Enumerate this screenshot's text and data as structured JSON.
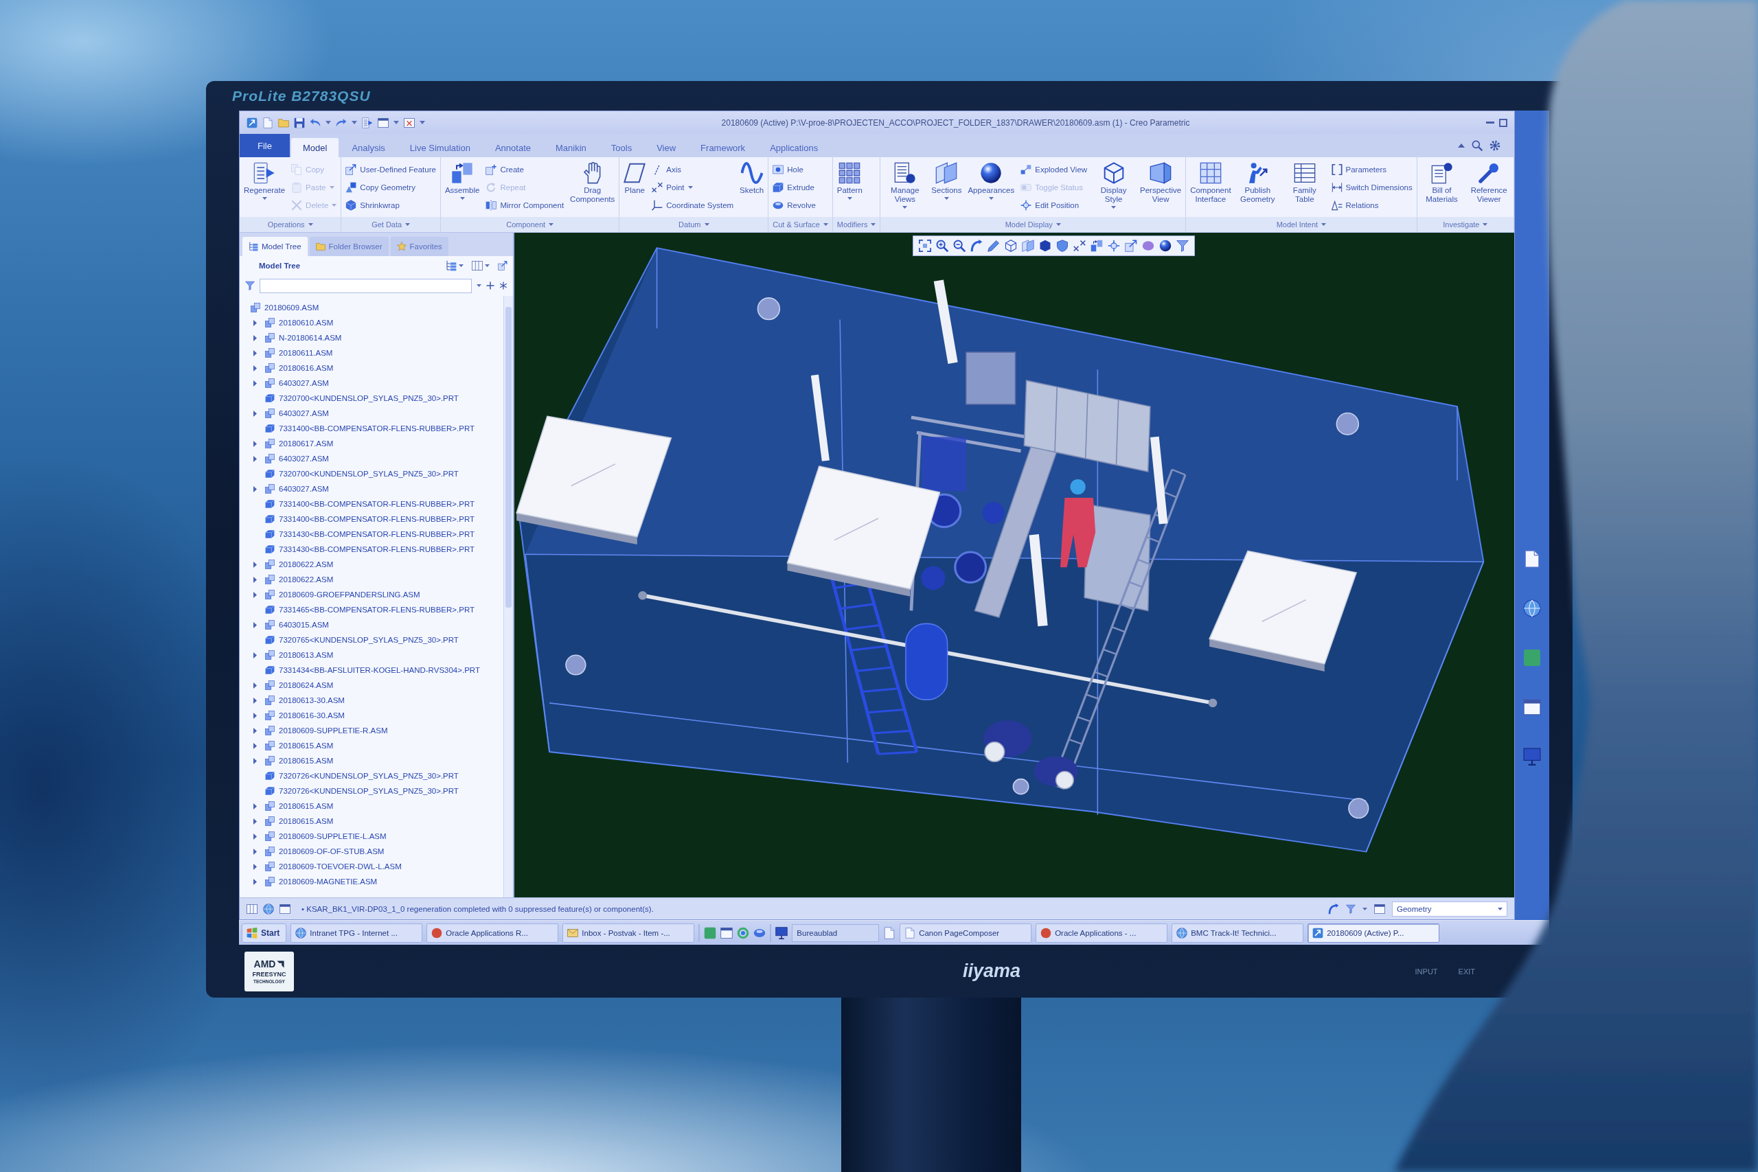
{
  "monitor": {
    "model": "ProLite B2783QSU",
    "logo": "iiyama",
    "sticker": {
      "brand": "AMD",
      "lines": [
        "FREESYNC",
        "TECHNOLOGY"
      ]
    },
    "buttons": [
      "INPUT",
      "EXIT"
    ]
  },
  "window": {
    "title": "20180609 (Active) P:\\V-proe-8\\PROJECTEN_ACCO\\PROJECT_FOLDER_1837\\DRAWER\\20180609.asm (1) - Creo Parametric"
  },
  "ribbon": {
    "tabs": [
      {
        "label": "File",
        "kind": "menu",
        "selected": false
      },
      {
        "label": "Model",
        "kind": "tab",
        "selected": true
      },
      {
        "label": "Analysis",
        "kind": "tab",
        "selected": false
      },
      {
        "label": "Live Simulation",
        "kind": "tab",
        "selected": false
      },
      {
        "label": "Annotate",
        "kind": "tab",
        "selected": false
      },
      {
        "label": "Manikin",
        "kind": "tab",
        "selected": false
      },
      {
        "label": "Tools",
        "kind": "tab",
        "selected": false
      },
      {
        "label": "View",
        "kind": "tab",
        "selected": false
      },
      {
        "label": "Framework",
        "kind": "tab",
        "selected": false
      },
      {
        "label": "Applications",
        "kind": "tab",
        "selected": false
      }
    ],
    "groups": [
      {
        "label": "Operations",
        "items": [
          {
            "label": "Regenerate",
            "kind": "large",
            "disabled": false,
            "dropdown": true
          },
          {
            "label": "Copy",
            "kind": "small",
            "disabled": true,
            "dropdown": false
          },
          {
            "label": "Paste",
            "kind": "small",
            "disabled": true,
            "dropdown": true
          },
          {
            "label": "Delete",
            "kind": "small",
            "disabled": true,
            "dropdown": true
          }
        ]
      },
      {
        "label": "Get Data",
        "items": [
          {
            "label": "User-Defined Feature",
            "kind": "small",
            "disabled": false,
            "dropdown": false
          },
          {
            "label": "Copy Geometry",
            "kind": "small",
            "disabled": false,
            "dropdown": false
          },
          {
            "label": "Shrinkwrap",
            "kind": "small",
            "disabled": false,
            "dropdown": false
          }
        ]
      },
      {
        "label": "Component",
        "items": [
          {
            "label": "Assemble",
            "kind": "large",
            "disabled": false,
            "dropdown": true
          },
          {
            "label": "Create",
            "kind": "small",
            "disabled": false,
            "dropdown": false
          },
          {
            "label": "Repeat",
            "kind": "small",
            "disabled": true,
            "dropdown": false
          },
          {
            "label": "Mirror Component",
            "kind": "small",
            "disabled": false,
            "dropdown": false
          },
          {
            "label": "Drag Components",
            "kind": "large",
            "disabled": false,
            "dropdown": false
          }
        ]
      },
      {
        "label": "Datum",
        "items": [
          {
            "label": "Plane",
            "kind": "large",
            "disabled": false,
            "dropdown": false
          },
          {
            "label": "Axis",
            "kind": "small",
            "disabled": false,
            "dropdown": false
          },
          {
            "label": "Point",
            "kind": "small",
            "disabled": false,
            "dropdown": true
          },
          {
            "label": "Coordinate System",
            "kind": "small",
            "disabled": false,
            "dropdown": false
          },
          {
            "label": "Sketch",
            "kind": "large",
            "disabled": false,
            "dropdown": false
          }
        ]
      },
      {
        "label": "Cut & Surface",
        "items": [
          {
            "label": "Hole",
            "kind": "small",
            "disabled": false,
            "dropdown": false
          },
          {
            "label": "Extrude",
            "kind": "small",
            "disabled": false,
            "dropdown": false
          },
          {
            "label": "Revolve",
            "kind": "small",
            "disabled": false,
            "dropdown": false
          }
        ]
      },
      {
        "label": "Modifiers",
        "items": [
          {
            "label": "Pattern",
            "kind": "large",
            "disabled": false,
            "dropdown": true
          }
        ]
      },
      {
        "label": "Model Display",
        "items": [
          {
            "label": "Manage Views",
            "kind": "large",
            "disabled": false,
            "dropdown": true
          },
          {
            "label": "Sections",
            "kind": "large",
            "disabled": false,
            "dropdown": true
          },
          {
            "label": "Appearances",
            "kind": "large",
            "disabled": false,
            "dropdown": true
          },
          {
            "label": "Exploded View",
            "kind": "small",
            "disabled": false,
            "dropdown": false
          },
          {
            "label": "Toggle Status",
            "kind": "small",
            "disabled": true,
            "dropdown": false
          },
          {
            "label": "Edit Position",
            "kind": "small",
            "disabled": false,
            "dropdown": false
          },
          {
            "label": "Display Style",
            "kind": "large",
            "disabled": false,
            "dropdown": true
          },
          {
            "label": "Perspective View",
            "kind": "large",
            "disabled": false,
            "dropdown": false
          }
        ]
      },
      {
        "label": "Model Intent",
        "items": [
          {
            "label": "Component Interface",
            "kind": "large",
            "disabled": false,
            "dropdown": false
          },
          {
            "label": "Publish Geometry",
            "kind": "large",
            "disabled": false,
            "dropdown": false
          },
          {
            "label": "Family Table",
            "kind": "large",
            "disabled": false,
            "dropdown": false
          },
          {
            "label": "Parameters",
            "kind": "small",
            "disabled": false,
            "dropdown": false
          },
          {
            "label": "Switch Dimensions",
            "kind": "small",
            "disabled": false,
            "dropdown": false
          },
          {
            "label": "Relations",
            "kind": "small",
            "disabled": false,
            "dropdown": false
          }
        ]
      },
      {
        "label": "Investigate",
        "items": [
          {
            "label": "Bill of Materials",
            "kind": "large",
            "disabled": false,
            "dropdown": false
          },
          {
            "label": "Reference Viewer",
            "kind": "large",
            "disabled": false,
            "dropdown": false
          }
        ]
      }
    ]
  },
  "model_tree": {
    "tabs": [
      {
        "label": "Model Tree",
        "selected": true
      },
      {
        "label": "Folder Browser",
        "selected": false
      },
      {
        "label": "Favorites",
        "selected": false
      }
    ],
    "heading": "Model Tree",
    "root": {
      "label": "20180609.ASM",
      "children": [
        {
          "label": "20180610.ASM",
          "kind": "assembly",
          "expanded": false
        },
        {
          "label": "N-20180614.ASM",
          "kind": "assembly",
          "expanded": false
        },
        {
          "label": "20180611.ASM",
          "kind": "assembly",
          "expanded": false
        },
        {
          "label": "20180616.ASM",
          "kind": "assembly",
          "expanded": false
        },
        {
          "label": "6403027.ASM",
          "kind": "assembly",
          "expanded": false
        },
        {
          "label": "7320700<KUNDENSLOP_SYLAS_PNZ5_30>.PRT",
          "kind": "part"
        },
        {
          "label": "6403027.ASM",
          "kind": "assembly",
          "expanded": false
        },
        {
          "label": "7331400<BB-COMPENSATOR-FLENS-RUBBER>.PRT",
          "kind": "part"
        },
        {
          "label": "20180617.ASM",
          "kind": "assembly",
          "expanded": false
        },
        {
          "label": "6403027.ASM",
          "kind": "assembly",
          "expanded": false
        },
        {
          "label": "7320700<KUNDENSLOP_SYLAS_PNZ5_30>.PRT",
          "kind": "part"
        },
        {
          "label": "6403027.ASM",
          "kind": "assembly",
          "expanded": false
        },
        {
          "label": "7331400<BB-COMPENSATOR-FLENS-RUBBER>.PRT",
          "kind": "part"
        },
        {
          "label": "7331400<BB-COMPENSATOR-FLENS-RUBBER>.PRT",
          "kind": "part"
        },
        {
          "label": "7331430<BB-COMPENSATOR-FLENS-RUBBER>.PRT",
          "kind": "part"
        },
        {
          "label": "7331430<BB-COMPENSATOR-FLENS-RUBBER>.PRT",
          "kind": "part"
        },
        {
          "label": "20180622.ASM",
          "kind": "assembly",
          "expanded": false
        },
        {
          "label": "20180622.ASM",
          "kind": "assembly",
          "expanded": false
        },
        {
          "label": "20180609-GROEFPANDERSLING.ASM",
          "kind": "assembly",
          "expanded": false
        },
        {
          "label": "7331465<BB-COMPENSATOR-FLENS-RUBBER>.PRT",
          "kind": "part"
        },
        {
          "label": "6403015.ASM",
          "kind": "assembly",
          "expanded": false
        },
        {
          "label": "7320765<KUNDENSLOP_SYLAS_PNZ5_30>.PRT",
          "kind": "part"
        },
        {
          "label": "20180613.ASM",
          "kind": "assembly",
          "expanded": false
        },
        {
          "label": "7331434<BB-AFSLUITER-KOGEL-HAND-RVS304>.PRT",
          "kind": "part"
        },
        {
          "label": "20180624.ASM",
          "kind": "assembly",
          "expanded": false
        },
        {
          "label": "20180613-30.ASM",
          "kind": "assembly",
          "expanded": false
        },
        {
          "label": "20180616-30.ASM",
          "kind": "assembly",
          "expanded": false
        },
        {
          "label": "20180609-SUPPLETIE-R.ASM",
          "kind": "assembly",
          "expanded": false
        },
        {
          "label": "20180615.ASM",
          "kind": "assembly",
          "expanded": false
        },
        {
          "label": "20180615.ASM",
          "kind": "assembly",
          "expanded": false
        },
        {
          "label": "7320726<KUNDENSLOP_SYLAS_PNZ5_30>.PRT",
          "kind": "part"
        },
        {
          "label": "7320726<KUNDENSLOP_SYLAS_PNZ5_30>.PRT",
          "kind": "part"
        },
        {
          "label": "20180615.ASM",
          "kind": "assembly",
          "expanded": false
        },
        {
          "label": "20180615.ASM",
          "kind": "assembly",
          "expanded": false
        },
        {
          "label": "20180609-SUPPLETIE-L.ASM",
          "kind": "assembly",
          "expanded": false
        },
        {
          "label": "20180609-OF-OF-STUB.ASM",
          "kind": "assembly",
          "expanded": false
        },
        {
          "label": "20180609-TOEVOER-DWL-L.ASM",
          "kind": "assembly",
          "expanded": false
        },
        {
          "label": "20180609-MAGNETIE.ASM",
          "kind": "assembly",
          "expanded": false
        }
      ]
    }
  },
  "status_bar": {
    "message": "• KSAR_BK1_VIR-DP03_1_0 regeneration completed with 0 suppressed feature(s) or component(s).",
    "filter": "Geometry"
  },
  "taskbar": {
    "start": "Start",
    "buttons_left": [
      {
        "label": "Intranet TPG - Internet ...",
        "selected": false
      },
      {
        "label": "Oracle Applications R...",
        "selected": false
      },
      {
        "label": "Inbox - Postvak - Item -...",
        "selected": false
      }
    ],
    "desktop_toolbar": "Bureaublad",
    "buttons_right": [
      {
        "label": "Canon PageComposer",
        "selected": false
      },
      {
        "label": "Oracle Applications - ...",
        "selected": false
      },
      {
        "label": "BMC Track-It! Technici...",
        "selected": false
      },
      {
        "label": "20180609 (Active) P...",
        "selected": true
      }
    ]
  }
}
